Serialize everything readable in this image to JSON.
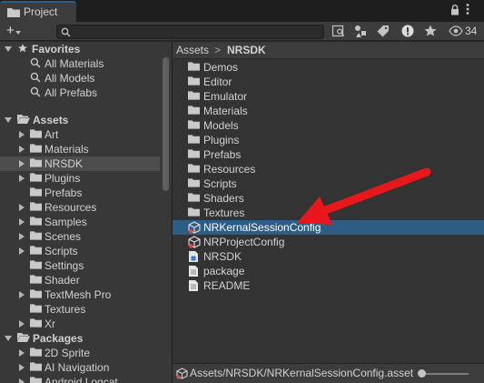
{
  "window": {
    "tab_label": "Project"
  },
  "toolbar": {
    "search": {
      "value": "",
      "placeholder": ""
    },
    "count": "34",
    "icons": [
      "plus-icon",
      "search-icon",
      "scene-search-icon",
      "filter-by-type-icon",
      "label-tag-icon",
      "warning-icon",
      "star-icon",
      "eye-icon"
    ]
  },
  "sidebar": {
    "favorites": {
      "label": "Favorites",
      "items": [
        "All Materials",
        "All Models",
        "All Prefabs"
      ]
    },
    "assets": {
      "label": "Assets",
      "items": [
        {
          "label": "Art",
          "expandable": true
        },
        {
          "label": "Materials",
          "expandable": true
        },
        {
          "label": "NRSDK",
          "expandable": true,
          "selected": true
        },
        {
          "label": "Plugins",
          "expandable": true
        },
        {
          "label": "Prefabs",
          "expandable": false
        },
        {
          "label": "Resources",
          "expandable": true
        },
        {
          "label": "Samples",
          "expandable": true
        },
        {
          "label": "Scenes",
          "expandable": true
        },
        {
          "label": "Scripts",
          "expandable": true
        },
        {
          "label": "Settings",
          "expandable": false
        },
        {
          "label": "Shader",
          "expandable": false
        },
        {
          "label": "TextMesh Pro",
          "expandable": true
        },
        {
          "label": "Textures",
          "expandable": false
        },
        {
          "label": "Xr",
          "expandable": true
        }
      ]
    },
    "packages": {
      "label": "Packages",
      "items": [
        {
          "label": "2D Sprite"
        },
        {
          "label": "AI Navigation"
        },
        {
          "label": "Android Logcat"
        }
      ]
    }
  },
  "breadcrumb": {
    "root": "Assets",
    "separator": ">",
    "current": "NRSDK"
  },
  "files": [
    {
      "label": "Demos",
      "icon": "folder-icon"
    },
    {
      "label": "Editor",
      "icon": "folder-icon"
    },
    {
      "label": "Emulator",
      "icon": "folder-icon"
    },
    {
      "label": "Materials",
      "icon": "folder-icon"
    },
    {
      "label": "Models",
      "icon": "folder-icon"
    },
    {
      "label": "Plugins",
      "icon": "folder-icon"
    },
    {
      "label": "Prefabs",
      "icon": "folder-icon"
    },
    {
      "label": "Resources",
      "icon": "folder-icon"
    },
    {
      "label": "Scripts",
      "icon": "folder-icon"
    },
    {
      "label": "Shaders",
      "icon": "folder-icon"
    },
    {
      "label": "Textures",
      "icon": "folder-icon"
    },
    {
      "label": "NRKernalSessionConfig",
      "icon": "scriptable-object-icon",
      "selected": true
    },
    {
      "label": "NRProjectConfig",
      "icon": "scriptable-object-warning-icon"
    },
    {
      "label": "NRSDK",
      "icon": "assembly-definition-icon"
    },
    {
      "label": "package",
      "icon": "text-file-icon"
    },
    {
      "label": "README",
      "icon": "text-file-icon"
    }
  ],
  "status": {
    "path": "Assets/NRSDK/NRKernalSessionConfig.asset",
    "zoom_fraction": 0
  },
  "colors": {
    "selection": "#2c5d87",
    "annotation_arrow": "#e8171c"
  }
}
